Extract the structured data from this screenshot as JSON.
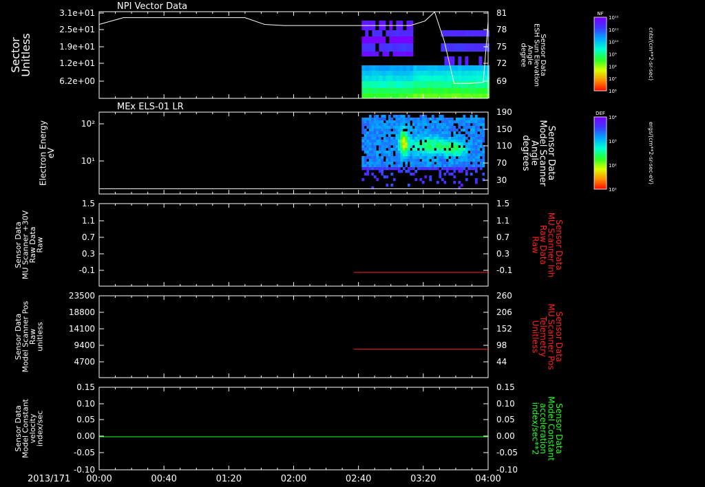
{
  "date_label": "2013/171",
  "x_ticks": [
    "00:00",
    "00:40",
    "01:20",
    "02:00",
    "02:40",
    "03:20",
    "04:00"
  ],
  "colors": {
    "axis": "#ffffff",
    "red": "#ff2020",
    "green": "#20ff20",
    "bg": "#000000"
  },
  "chart_data": [
    {
      "type": "heatmap",
      "title": "NPI Vector Data",
      "ylabel": [
        "Sector",
        "Unitless"
      ],
      "yticks": [
        "3.1e+01",
        "2.5e+01",
        "1.9e+01",
        "1.2e+01",
        "6.2e+00"
      ],
      "right_ylabel": [
        "Sensor Data",
        "ESH Sun Elevation",
        "Angle",
        "degree"
      ],
      "right_yticks": [
        "81",
        "78",
        "75",
        "72",
        "69"
      ],
      "colorbar": {
        "label": "NF",
        "ticks": [
          "10¹²",
          "10¹¹",
          "10¹⁰",
          "10⁹",
          "10⁸",
          "10⁷",
          "10⁶"
        ],
        "unit": "cnts/(cm**2-sr-sec)"
      },
      "line_series": {
        "name": "ESH Sun Elevation Angle",
        "x_hours": [
          0,
          0.25,
          0.6,
          1.5,
          1.7,
          1.9,
          3.2,
          3.35,
          3.45,
          3.55,
          3.65,
          3.8,
          3.95,
          4.0
        ],
        "y": [
          79.0,
          80.2,
          80.2,
          80.2,
          79.0,
          78.8,
          78.8,
          79.6,
          81.2,
          76.0,
          68.6,
          68.6,
          68.8,
          79.5
        ]
      },
      "data_start_hours": 2.7
    },
    {
      "type": "heatmap",
      "title": "MEx ELS-01 LR",
      "ylabel": [
        "Electron Energy",
        "eV"
      ],
      "yticks": [
        "10²",
        "10¹"
      ],
      "right_ylabel": [
        "Sensor Data",
        "Model Scanner",
        "Angle",
        "degrees"
      ],
      "right_yticks": [
        "190",
        "150",
        "110",
        "70",
        "30"
      ],
      "colorbar": {
        "label": "DEF",
        "ticks": [
          "10⁴",
          "10³",
          "10²",
          "10¹"
        ],
        "unit": "ergs/(cm**2-sr-sec-eV)"
      },
      "line_series": {
        "name": "Model Scanner Angle",
        "x_hours": [
          0,
          4
        ],
        "y": [
          10,
          10
        ]
      },
      "data_start_hours": 2.7
    },
    {
      "type": "line",
      "ylabel": [
        "Sensor Data",
        "MU Scanner +30V",
        "Raw Data",
        "Raw"
      ],
      "yticks": [
        "1.5",
        "1.1",
        "0.7",
        "0.3",
        "-0.1"
      ],
      "ylim": [
        -0.3,
        1.5
      ],
      "right_ylabel": [
        "Sensor Data",
        "MU Scanner Inh",
        "Raw Data",
        "Raw"
      ],
      "right_yticks": [
        "1.5",
        "1.1",
        "0.7",
        "0.3",
        "-0.1"
      ],
      "series": [
        {
          "x_hours": [
            2.62,
            4.0
          ],
          "y": [
            0.0,
            0.0
          ],
          "color": "#ff2020"
        }
      ]
    },
    {
      "type": "line",
      "ylabel": [
        "Sensor Data",
        "Model Scanner Pos",
        "Raw",
        "unitless"
      ],
      "yticks": [
        "23500",
        "18800",
        "14100",
        "9400",
        "4700"
      ],
      "ylim": [
        0,
        23500
      ],
      "right_ylabel": [
        "Sensor Data",
        "MU Scanner Pos",
        "Telemetry",
        "Unitless"
      ],
      "right_yticks": [
        "260",
        "206",
        "152",
        "98",
        "44"
      ],
      "series": [
        {
          "x_hours": [
            2.62,
            4.0
          ],
          "y": [
            8150,
            8150
          ],
          "color": "#ff2020"
        }
      ]
    },
    {
      "type": "line",
      "ylabel": [
        "Sensor Data",
        "Model Constant",
        "velocity",
        "index/sec"
      ],
      "yticks": [
        "0.15",
        "0.10",
        "0.05",
        "0.00",
        "-0.05",
        "-0.10"
      ],
      "ylim": [
        -0.1,
        0.15
      ],
      "right_ylabel": [
        "Sensor Data",
        "Model Constant",
        "acceleration",
        "index/sec**2"
      ],
      "right_yticks": [
        "0.15",
        "0.10",
        "0.05",
        "0.00",
        "-0.05",
        "-0.10"
      ],
      "series": [
        {
          "x_hours": [
            0,
            4.0
          ],
          "y": [
            0.0,
            0.0
          ],
          "color": "#20ff20"
        }
      ]
    }
  ]
}
